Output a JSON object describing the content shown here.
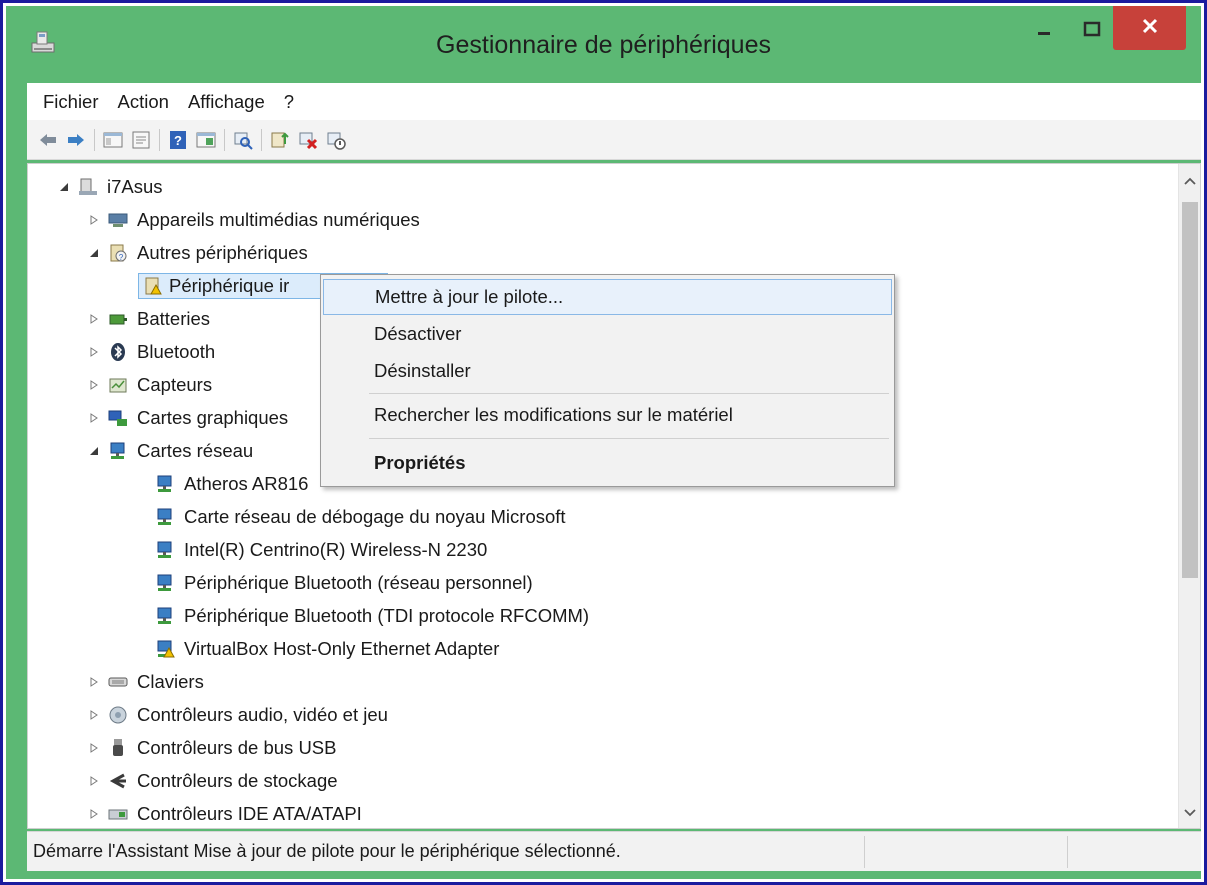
{
  "window": {
    "title": "Gestionnaire de périphériques",
    "accent_color": "#5cb874",
    "close_color": "#c7413a",
    "buttons": {
      "minimize": "minimize-icon",
      "maximize": "maximize-icon",
      "close": "close-icon"
    }
  },
  "menubar": {
    "items": [
      {
        "label": "Fichier"
      },
      {
        "label": "Action"
      },
      {
        "label": "Affichage"
      },
      {
        "label": "?"
      }
    ]
  },
  "toolbar": {
    "buttons": [
      "back-arrow-icon",
      "forward-arrow-icon",
      "show-hide-console-tree-icon",
      "properties-icon",
      "help-icon",
      "view-icon",
      "scan-hardware-icon",
      "update-driver-icon",
      "uninstall-device-icon",
      "disable-device-icon"
    ]
  },
  "tree": {
    "root": {
      "label": "i7Asus",
      "icon": "computer-icon",
      "expanded": true
    },
    "categories": [
      {
        "label": "Appareils multimédias numériques",
        "icon": "multimedia-device-icon",
        "expanded": false
      },
      {
        "label": "Autres périphériques",
        "icon": "unknown-device-icon",
        "expanded": true,
        "children": [
          {
            "label": "Périphérique ir",
            "icon": "unknown-device-warning-icon",
            "selected": true
          }
        ]
      },
      {
        "label": "Batteries",
        "icon": "battery-icon",
        "expanded": false
      },
      {
        "label": "Bluetooth",
        "icon": "bluetooth-icon",
        "expanded": false
      },
      {
        "label": "Capteurs",
        "icon": "sensor-icon",
        "expanded": false
      },
      {
        "label": "Cartes graphiques",
        "icon": "display-adapter-icon",
        "expanded": false
      },
      {
        "label": "Cartes réseau",
        "icon": "network-adapter-icon",
        "expanded": true,
        "children": [
          {
            "label": "Atheros AR816",
            "icon": "network-adapter-icon"
          },
          {
            "label": "Carte réseau de débogage du noyau Microsoft",
            "icon": "network-adapter-icon"
          },
          {
            "label": "Intel(R) Centrino(R) Wireless-N 2230",
            "icon": "network-adapter-icon"
          },
          {
            "label": "Périphérique Bluetooth (réseau personnel)",
            "icon": "network-adapter-icon"
          },
          {
            "label": "Périphérique Bluetooth (TDI protocole RFCOMM)",
            "icon": "network-adapter-icon"
          },
          {
            "label": "VirtualBox Host-Only Ethernet Adapter",
            "icon": "network-adapter-warning-icon"
          }
        ]
      },
      {
        "label": "Claviers",
        "icon": "keyboard-icon",
        "expanded": false
      },
      {
        "label": "Contrôleurs audio, vidéo et jeu",
        "icon": "audio-controller-icon",
        "expanded": false
      },
      {
        "label": "Contrôleurs de bus USB",
        "icon": "usb-icon",
        "expanded": false
      },
      {
        "label": "Contrôleurs de stockage",
        "icon": "storage-controller-icon",
        "expanded": false
      },
      {
        "label": "Contrôleurs IDE ATA/ATAPI",
        "icon": "ide-controller-icon",
        "expanded": false
      }
    ]
  },
  "context_menu": {
    "items": [
      {
        "label": "Mettre à jour le pilote...",
        "highlighted": true
      },
      {
        "label": "Désactiver"
      },
      {
        "label": "Désinstaller"
      },
      {
        "label": "Rechercher les modifications sur le matériel"
      },
      {
        "label": "Propriétés",
        "bold": true
      }
    ]
  },
  "statusbar": {
    "text": "Démarre l'Assistant Mise à jour de pilote pour le périphérique sélectionné."
  },
  "scrollbar": {
    "up_icon": "chevron-up-icon",
    "down_icon": "chevron-down-icon"
  }
}
